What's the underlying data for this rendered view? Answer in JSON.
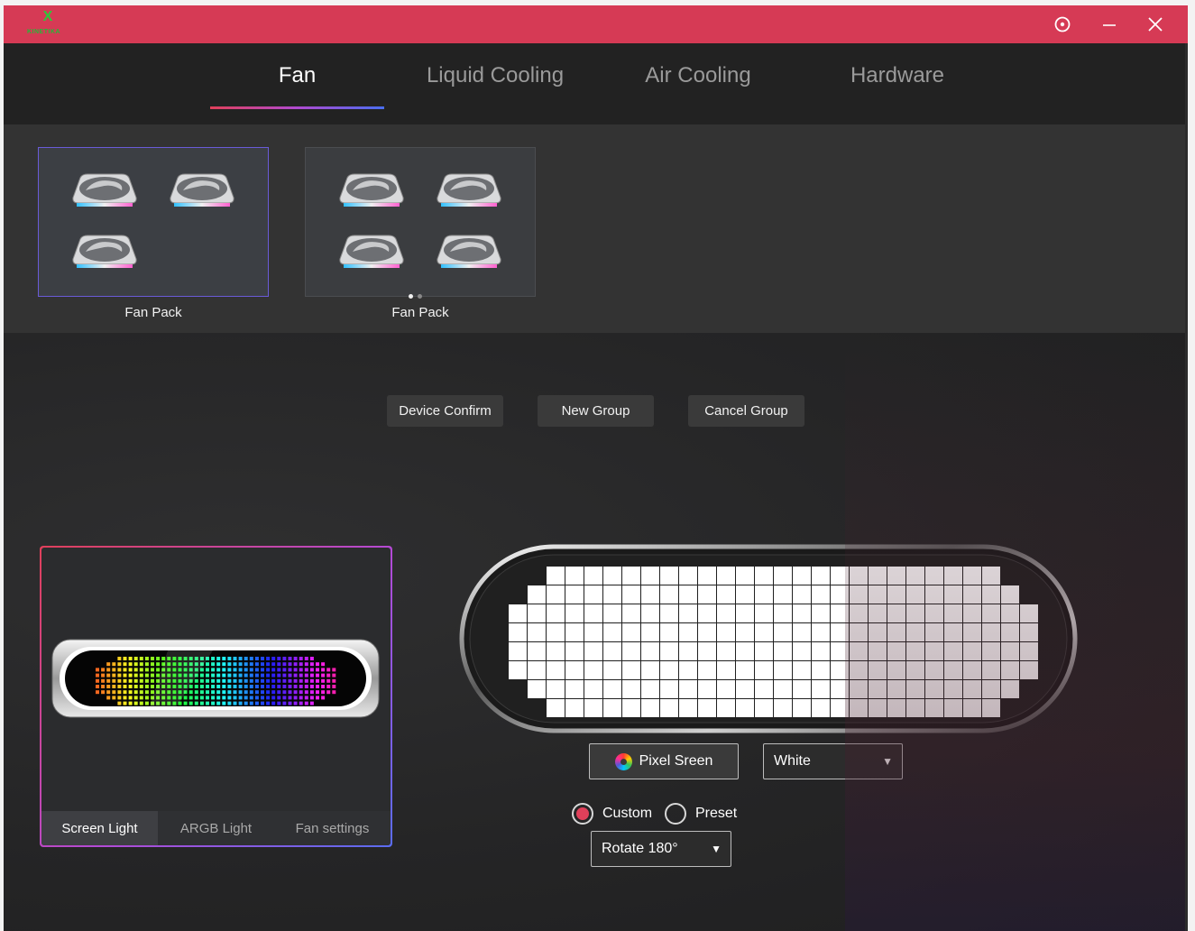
{
  "app": {
    "logo_text": "KINETIKA",
    "logo_mark": "X"
  },
  "titlebar": {
    "icons": [
      "target-icon",
      "minimize-icon",
      "close-icon"
    ]
  },
  "tabs": [
    {
      "label": "Fan",
      "active": true
    },
    {
      "label": "Liquid Cooling",
      "active": false
    },
    {
      "label": "Air Cooling",
      "active": false
    },
    {
      "label": "Hardware",
      "active": false
    }
  ],
  "devices": [
    {
      "label": "Fan Pack",
      "fan_count": 3,
      "selected": true
    },
    {
      "label": "Fan Pack",
      "fan_count": 4,
      "selected": false,
      "pager_dots": 2
    }
  ],
  "group_buttons": {
    "confirm": "Device Confirm",
    "new": "New Group",
    "cancel": "Cancel Group"
  },
  "preview": {
    "subtabs": [
      {
        "label": "Screen Light",
        "active": true
      },
      {
        "label": "ARGB Light",
        "active": false
      },
      {
        "label": "Fan settings",
        "active": false
      }
    ]
  },
  "pixel_editor": {
    "pixel_button": "Pixel Sreen",
    "color_select": "White",
    "mode": "Custom",
    "radio_custom": "Custom",
    "radio_preset": "Preset",
    "rotate_select": "Rotate 180°"
  },
  "colors": {
    "accent": "#d63a55",
    "purple": "#b44ad6",
    "blue": "#5a6cf0"
  }
}
